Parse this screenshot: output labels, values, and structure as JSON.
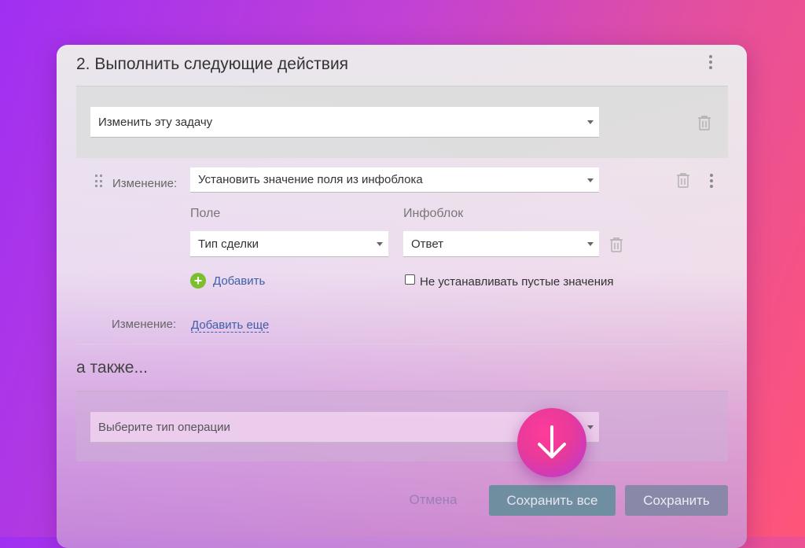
{
  "panel": {
    "title": "2. Выполнить следующие действия"
  },
  "action": {
    "type_value": "Изменить эту задачу"
  },
  "change": {
    "label": "Изменение:",
    "value": "Установить значение поля из инфоблока",
    "field_label": "Поле",
    "field_value": "Тип сделки",
    "infoblock_label": "Инфоблок",
    "infoblock_value": "Ответ",
    "add_label": "Добавить",
    "skip_empty_label": "Не устанавливать пустые значения",
    "skip_empty_checked": false
  },
  "change_more": {
    "label": "Изменение:",
    "link": "Добавить еще"
  },
  "also": {
    "title": "а также...",
    "operation_placeholder": "Выберите тип операции"
  },
  "footer": {
    "cancel_label": "Отмена",
    "save_all_label": "Сохранить все",
    "save_label": "Сохранить"
  },
  "icons": {
    "kebab": "more-vertical-icon",
    "trash": "trash-icon",
    "drag": "drag-handle-icon",
    "plus": "plus-circle-icon",
    "fab": "arrow-down-icon"
  },
  "colors": {
    "link": "#3d5fa8",
    "add_icon": "#7cbf2e",
    "save_all_button": "#6f8fa0",
    "save_button": "#8a88a8",
    "fab": "#e83a9a"
  }
}
